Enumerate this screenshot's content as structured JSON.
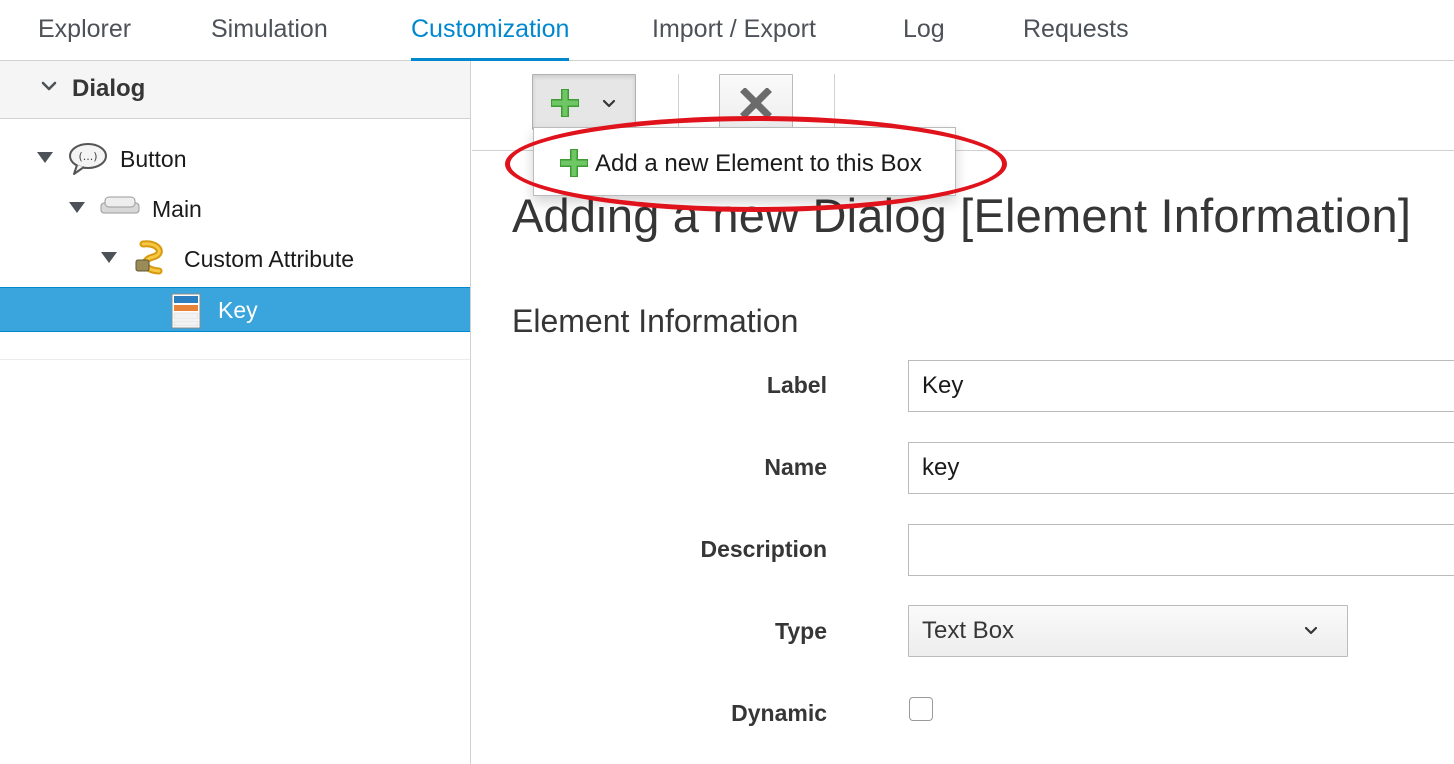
{
  "tabs": [
    {
      "label": "Explorer",
      "active": false
    },
    {
      "label": "Simulation",
      "active": false
    },
    {
      "label": "Customization",
      "active": true
    },
    {
      "label": "Import / Export",
      "active": false
    },
    {
      "label": "Log",
      "active": false
    },
    {
      "label": "Requests",
      "active": false
    }
  ],
  "sidebar": {
    "accordion_title": "Dialog",
    "tree": [
      {
        "label": "Button",
        "icon": "speech-bubble-icon",
        "expanded": true,
        "selected": false
      },
      {
        "label": "Main",
        "icon": "tab-icon",
        "expanded": true,
        "selected": false
      },
      {
        "label": "Custom Attribute",
        "icon": "custom-attribute-icon",
        "expanded": true,
        "selected": false
      },
      {
        "label": "Key",
        "icon": "text-box-element-icon",
        "expanded": false,
        "selected": true
      }
    ]
  },
  "toolbar": {
    "add_button_icon": "plus-icon",
    "delete_button_icon": "delete-x-icon",
    "menu": {
      "items": [
        {
          "label": "Add a new Element to this Box",
          "icon": "plus-icon"
        }
      ]
    }
  },
  "main": {
    "title": "Adding a new Dialog [Element Information]",
    "section_title": "Element Information",
    "form": {
      "label": {
        "label": "Label",
        "value": "Key"
      },
      "name": {
        "label": "Name",
        "value": "key"
      },
      "description": {
        "label": "Description",
        "value": ""
      },
      "type": {
        "label": "Type",
        "value": "Text Box"
      },
      "dynamic": {
        "label": "Dynamic",
        "checked": false
      }
    }
  },
  "colors": {
    "accent": "#0088ce",
    "selection": "#39a5dc",
    "annotation": "#e0121b",
    "plus_green": "#3f9c35"
  }
}
